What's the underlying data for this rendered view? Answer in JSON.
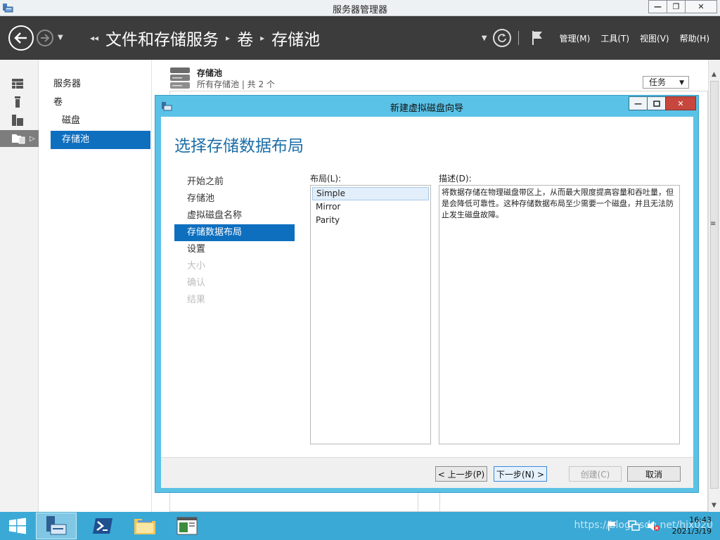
{
  "window": {
    "title": "服务器管理器",
    "minimize": "—",
    "restore": "❐",
    "close": "✕"
  },
  "nav": {
    "breadcrumb": [
      "文件和存储服务",
      "卷",
      "存储池"
    ],
    "menu": [
      "管理(M)",
      "工具(T)",
      "视图(V)",
      "帮助(H)"
    ]
  },
  "rail": [
    "dashboard-icon",
    "local-server-icon",
    "all-servers-icon",
    "file-storage-icon"
  ],
  "subnav": {
    "items": [
      {
        "label": "服务器"
      },
      {
        "label": "卷"
      },
      {
        "label": "磁盘"
      },
      {
        "label": "存储池"
      }
    ]
  },
  "pool": {
    "title": "存储池",
    "subtitle": "所有存储池 | 共 2 个",
    "tasks_label": "任务"
  },
  "wizard": {
    "title": "新建虚拟磁盘向导",
    "heading": "选择存储数据布局",
    "steps": [
      "开始之前",
      "存储池",
      "虚拟磁盘名称",
      "存储数据布局",
      "设置",
      "大小",
      "确认",
      "结果"
    ],
    "current_step": "存储数据布局",
    "layout_label": "布局(L):",
    "layouts": [
      "Simple",
      "Mirror",
      "Parity"
    ],
    "selected_layout": "Simple",
    "description_label": "描述(D):",
    "description": "将数据存储在物理磁盘带区上，从而最大限度提高容量和吞吐量，但是会降低可靠性。这种存储数据布局至少需要一个磁盘，并且无法防止发生磁盘故障。",
    "buttons": {
      "prev": "< 上一步(P)",
      "next": "下一步(N) >",
      "create": "创建(C)",
      "cancel": "取消"
    }
  },
  "taskbar": {
    "time": "16:43",
    "date": "2021/3/19",
    "watermark": "https://blog.csdn.net/hjx020"
  },
  "colors": {
    "accent": "#0f6fbf",
    "nav_bg": "#3c3c3c",
    "dialog_frame": "#5ac2e6",
    "taskbar": "#3ba9d6",
    "heading": "#1c6ea8"
  }
}
